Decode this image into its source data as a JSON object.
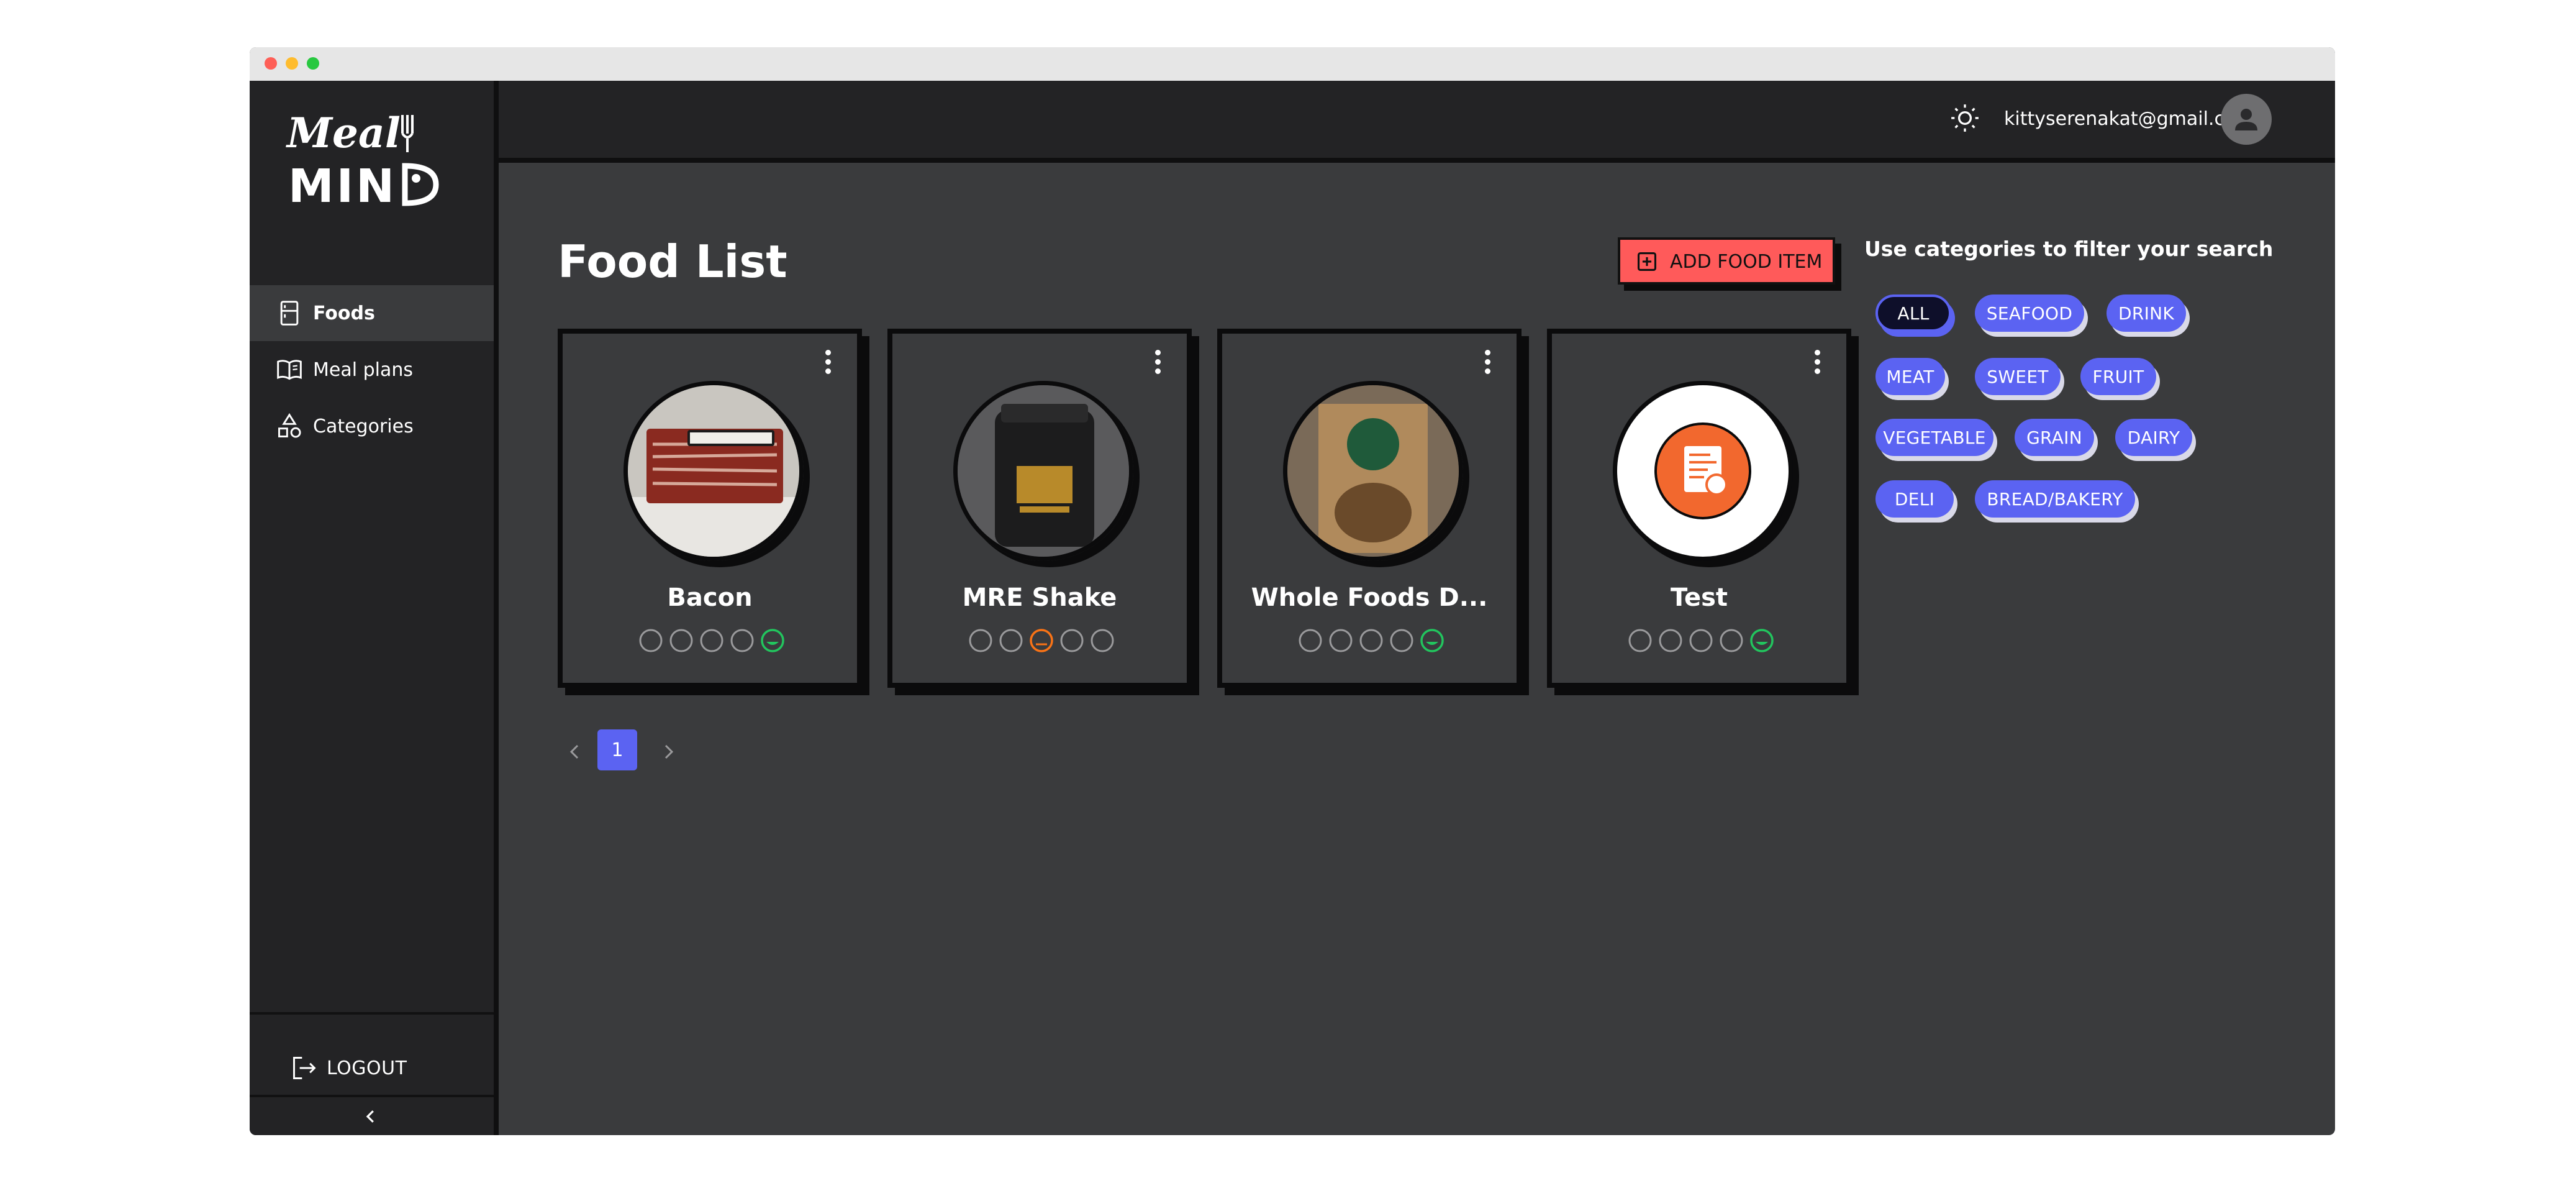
{
  "app": {
    "brand": "Meal MIND",
    "accent_color": "#5b63f2",
    "danger_color": "#ff5a5a"
  },
  "sidebar": {
    "items": [
      {
        "label": "Foods",
        "icon": "fridge-icon",
        "active": true
      },
      {
        "label": "Meal plans",
        "icon": "book-icon",
        "active": false
      },
      {
        "label": "Categories",
        "icon": "shapes-icon",
        "active": false
      }
    ],
    "logout_label": "LOGOUT",
    "collapse_icon": "chevron-left-icon"
  },
  "header": {
    "theme_icon": "sun-icon",
    "user_email": "kittyserenakat@gmail.com",
    "avatar_icon": "user-avatar-icon"
  },
  "main": {
    "title": "Food List",
    "add_button_label": "ADD FOOD ITEM",
    "filter_title": "Use categories to filter your search",
    "categories": [
      {
        "label": "ALL",
        "active": true
      },
      {
        "label": "SEAFOOD",
        "active": false
      },
      {
        "label": "DRINK",
        "active": false
      },
      {
        "label": "MEAT",
        "active": false
      },
      {
        "label": "SWEET",
        "active": false
      },
      {
        "label": "FRUIT",
        "active": false
      },
      {
        "label": "VEGETABLE",
        "active": false
      },
      {
        "label": "GRAIN",
        "active": false
      },
      {
        "label": "DAIRY",
        "active": false
      },
      {
        "label": "DELI",
        "active": false
      },
      {
        "label": "BREAD/BAKERY",
        "active": false
      }
    ],
    "foods": [
      {
        "name": "Bacon",
        "rating": 5,
        "rating_color": "#22c55e"
      },
      {
        "name": "MRE Shake",
        "rating": 3,
        "rating_color": "#f97316"
      },
      {
        "name": "Whole Foods D...",
        "rating": 5,
        "rating_color": "#22c55e"
      },
      {
        "name": "Test",
        "rating": 5,
        "rating_color": "#22c55e"
      }
    ],
    "pagination": {
      "current_page": "1"
    }
  }
}
